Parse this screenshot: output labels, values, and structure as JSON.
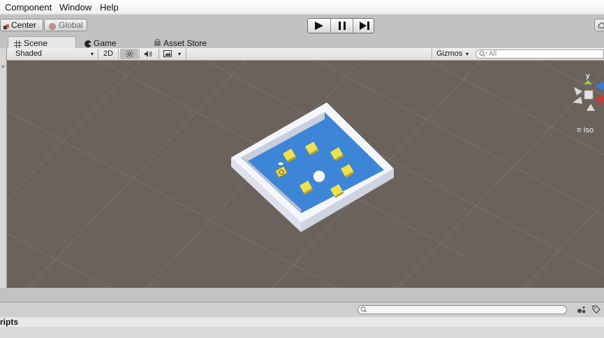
{
  "menu": [
    "Component",
    "Window",
    "Help"
  ],
  "toolbar": {
    "pivot_label": "Center",
    "space_label": "Global",
    "play_icons": [
      "play-icon",
      "pause-icon",
      "step-icon"
    ]
  },
  "tabs": [
    {
      "label": "Scene",
      "icon": "grid-icon",
      "active": true
    },
    {
      "label": "Game",
      "icon": "pacman-icon",
      "active": false
    },
    {
      "label": "Asset Store",
      "icon": "store-icon",
      "active": false
    }
  ],
  "scene_toolbar": {
    "draw_mode": "Shaded",
    "mode_2d": "2D",
    "gizmos": "Gizmos",
    "search_placeholder": "All"
  },
  "gizmo": {
    "axis_label": "y",
    "projection": "Iso",
    "colors": {
      "y": "#8cd33a",
      "x": "#d4382a",
      "z": "#3a78d8",
      "neutral": "#d8d8d8"
    }
  },
  "scene": {
    "background": "#6b625c",
    "floor_color": "#3d85d6",
    "wall_color": "#f2f4fb",
    "pickup_color": "#f0e050",
    "pickup_count": 6
  },
  "bottom": {
    "panel_title": "ripts"
  }
}
